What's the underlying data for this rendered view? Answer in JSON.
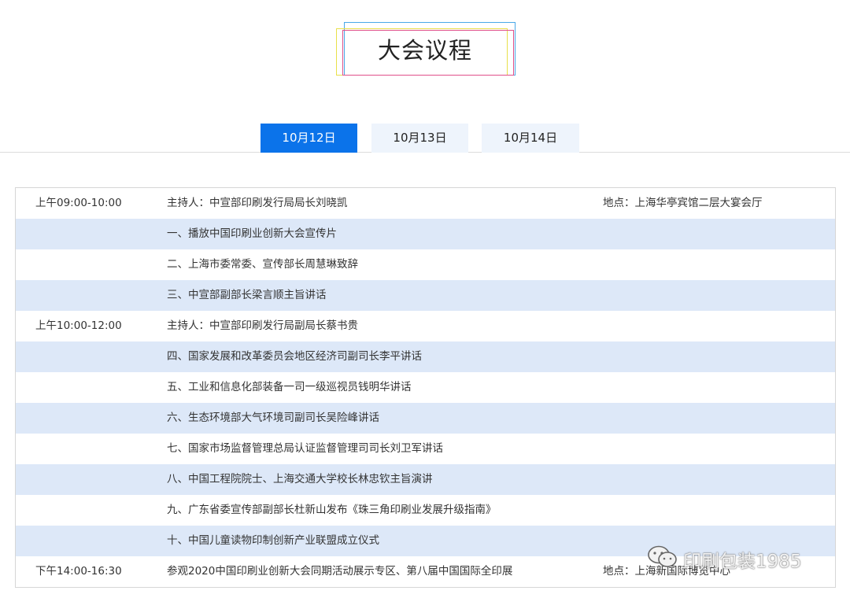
{
  "page_title": "大会议程",
  "tabs": [
    {
      "label": "10月12日",
      "active": true
    },
    {
      "label": "10月13日",
      "active": false
    },
    {
      "label": "10月14日",
      "active": false
    }
  ],
  "rows": [
    {
      "time": "上午09:00-10:00",
      "desc": "主持人：中宣部印刷发行局局长刘晓凯",
      "loc": "地点：上海华亭宾馆二层大宴会厅"
    },
    {
      "time": "",
      "desc": "一、播放中国印刷业创新大会宣传片",
      "loc": ""
    },
    {
      "time": "",
      "desc": "二、上海市委常委、宣传部长周慧琳致辞",
      "loc": ""
    },
    {
      "time": "",
      "desc": "三、中宣部副部长梁言顺主旨讲话",
      "loc": ""
    },
    {
      "time": "上午10:00-12:00",
      "desc": "主持人：中宣部印刷发行局副局长蔡书贵",
      "loc": ""
    },
    {
      "time": "",
      "desc": "四、国家发展和改革委员会地区经济司副司长李平讲话",
      "loc": ""
    },
    {
      "time": "",
      "desc": "五、工业和信息化部装备一司一级巡视员钱明华讲话",
      "loc": ""
    },
    {
      "time": "",
      "desc": "六、生态环境部大气环境司副司长吴险峰讲话",
      "loc": ""
    },
    {
      "time": "",
      "desc": "七、国家市场监督管理总局认证监督管理司司长刘卫军讲话",
      "loc": ""
    },
    {
      "time": "",
      "desc": "八、中国工程院院士、上海交通大学校长林忠钦主旨演讲",
      "loc": ""
    },
    {
      "time": "",
      "desc": "九、广东省委宣传部副部长杜新山发布《珠三角印刷业发展升级指南》",
      "loc": ""
    },
    {
      "time": "",
      "desc": "十、中国儿童读物印制创新产业联盟成立仪式",
      "loc": ""
    },
    {
      "time": "下午14:00-16:30",
      "desc": "参观2020中国印刷业创新大会同期活动展示专区、第八届中国国际全印展",
      "loc": "地点：上海新国际博览中心"
    }
  ],
  "watermark": {
    "text": "印刷包装1985",
    "icon": "wechat-icon"
  },
  "colors": {
    "accent": "#0b73ea",
    "row_shade": "#dde8f8",
    "tab_inactive": "#eef4fc"
  }
}
